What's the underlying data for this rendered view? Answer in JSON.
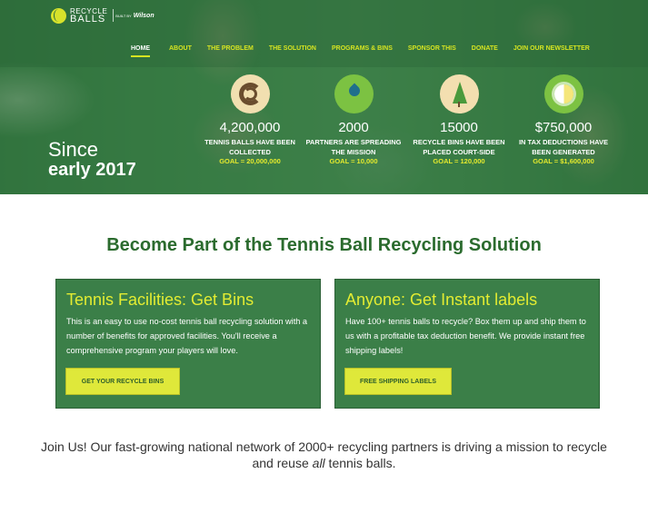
{
  "brand": {
    "name_line1": "RECYCLE",
    "name_line2": "BALLS",
    "by_text": "BUILT BY",
    "partner": "Wilson"
  },
  "nav": {
    "items": [
      {
        "label": "HOME",
        "active": true
      },
      {
        "label": "ABOUT"
      },
      {
        "label": "THE PROBLEM"
      },
      {
        "label": "THE SOLUTION"
      },
      {
        "label": "PROGRAMS & BINS"
      },
      {
        "label": "SPONSOR THIS"
      },
      {
        "label": "DONATE"
      },
      {
        "label": "JOIN OUR NEWSLETTER"
      }
    ]
  },
  "hero": {
    "since_line1": "Since",
    "since_line2": "early 2017",
    "stats": [
      {
        "icon": "recycle-icon",
        "number": "4,200,000",
        "desc": "TENNIS BALLS HAVE BEEN COLLECTED",
        "goal": "GOAL = 20,000,000"
      },
      {
        "icon": "water-drop-icon",
        "number": "2000",
        "desc": "PARTNERS ARE SPREADING THE MISSION",
        "goal": "GOAL = 10,000"
      },
      {
        "icon": "tree-icon",
        "number": "15000",
        "desc": "RECYCLE BINS HAVE BEEN PLACED COURT-SIDE",
        "goal": "GOAL = 120,000"
      },
      {
        "icon": "sun-icon",
        "number": "$750,000",
        "desc": "IN TAX DEDUCTIONS HAVE BEEN GENERATED",
        "goal": "GOAL = $1,600,000"
      }
    ]
  },
  "main": {
    "headline": "Become Part of the Tennis Ball Recycling Solution",
    "cards": [
      {
        "title": "Tennis Facilities: Get Bins",
        "body": "This is an easy to use no-cost tennis ball recycling solution with a number of benefits for approved facilities. You'll receive a comprehensive program your players will love.",
        "button": "GET YOUR RECYCLE BINS"
      },
      {
        "title": "Anyone: Get Instant labels",
        "body": "Have 100+ tennis balls to recycle? Box them up and ship them to us with a profitable tax deduction benefit. We provide instant free shipping labels!",
        "button": "FREE SHIPPING LABELS"
      }
    ],
    "join_text_before": "Join Us! Our fast-growing national network of 2000+ recycling partners is driving a mission to recycle and reuse ",
    "join_text_em": "all",
    "join_text_after": " tennis balls."
  },
  "colors": {
    "accent_yellow": "#d6e421",
    "brand_green": "#2b6b2e",
    "card_green": "#3b7f48"
  }
}
